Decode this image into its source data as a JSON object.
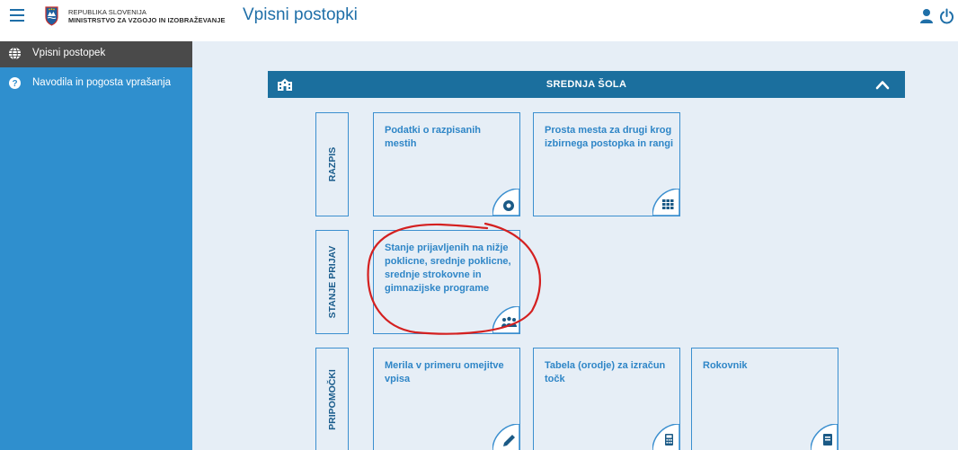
{
  "header": {
    "ministry_line1": "REPUBLIKA SLOVENIJA",
    "ministry_line2": "MINISTRSTVO ZA VZGOJO IN IZOBRAŽEVANJE",
    "page_title": "Vpisni postopki"
  },
  "sidebar": {
    "items": [
      {
        "label": "Vpisni postopek",
        "icon": "globe-icon",
        "active": true
      },
      {
        "label": "Navodila in pogosta vprašanja",
        "icon": "help-icon",
        "active": false
      }
    ]
  },
  "section": {
    "title": "SREDNJA ŠOLA",
    "icon": "school-icon",
    "collapse_icon": "chevron-up-icon"
  },
  "groups": [
    {
      "label": "RAZPIS",
      "tiles": [
        {
          "text": "Podatki o razpisanih mestih",
          "icon": "eye-icon"
        },
        {
          "text": "Prosta mesta za drugi krog izbirnega postopka in rangi",
          "icon": "grid-icon"
        }
      ]
    },
    {
      "label": "STANJE PRIJAV",
      "tiles": [
        {
          "text": "Stanje prijavljenih na nižje poklicne, srednje poklicne, srednje strokovne in gimnazijske programe",
          "icon": "people-icon"
        }
      ]
    },
    {
      "label": "PRIPOMOČKI",
      "tiles": [
        {
          "text": "Merila v primeru omejitve vpisa",
          "icon": "pencil-icon"
        },
        {
          "text": "Tabela (orodje) za izračun točk",
          "icon": "calculator-icon"
        },
        {
          "text": "Rokovnik",
          "icon": "book-icon"
        }
      ]
    }
  ],
  "colors": {
    "sidebar": "#2f8fce",
    "sidebar_active": "#4a4a4a",
    "section_bar": "#1b6f9e",
    "tile_border": "#3b8fcf",
    "main_bg": "#e6eef6",
    "annotation": "#d42020"
  }
}
